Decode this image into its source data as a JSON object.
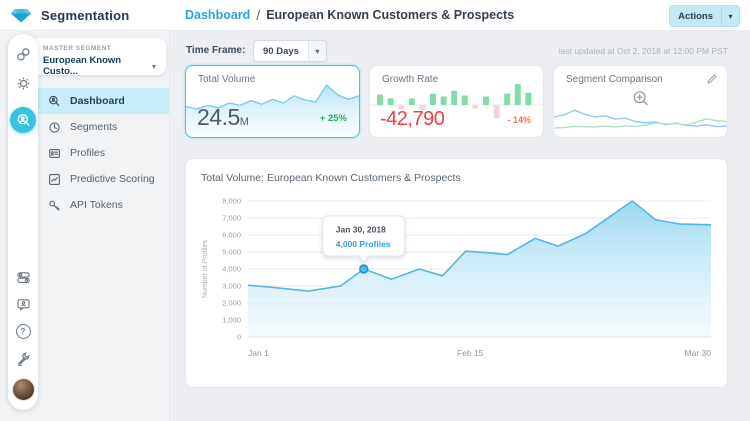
{
  "colors": {
    "accent": "#35c3df",
    "accent_light": "#c9edf6",
    "link_blue": "#2aa3dc",
    "positive_green": "#27ae60",
    "negative_red": "#ef4049",
    "warn_orange": "#f2714b"
  },
  "app": {
    "title": "Segmentation"
  },
  "header": {
    "breadcrumb_link": "Dashboard",
    "breadcrumb_separator": "/",
    "breadcrumb_current": "European Known Customers & Prospects",
    "actions_label": "Actions"
  },
  "icons": {
    "chevron_down": "▾",
    "help_glyph": "?"
  },
  "rail": {
    "top_icons": [
      "links-icon",
      "gear-icon",
      "search-user-icon"
    ],
    "active_icon": "search-user-icon",
    "bottom_icons": [
      "toggles-icon",
      "contact-chat-icon",
      "help-icon",
      "wrench-icon",
      "user-avatar"
    ]
  },
  "sidebar": {
    "master_segment_label": "MASTER SEGMENT",
    "master_segment_value": "European Known Custo...",
    "items": [
      {
        "label": "Dashboard",
        "icon": "dashboard-search-icon",
        "active": true
      },
      {
        "label": "Segments",
        "icon": "segments-clock-icon",
        "active": false
      },
      {
        "label": "Profiles",
        "icon": "profiles-card-icon",
        "active": false
      },
      {
        "label": "Predictive Scoring",
        "icon": "predictive-chart-icon",
        "active": false
      },
      {
        "label": "API Tokens",
        "icon": "api-key-icon",
        "active": false
      }
    ]
  },
  "toolbar": {
    "time_frame_label": "Time Frame:",
    "time_frame_value": "90 Days",
    "last_updated": "last updated at Oct 2, 2018 at 12:00 PM PST"
  },
  "cards": {
    "total_volume": {
      "title": "Total Volume",
      "value": "24.5",
      "unit": "M",
      "delta": "+ 25%"
    },
    "growth_rate": {
      "title": "Growth Rate",
      "value": "-42,790",
      "delta": "- 14%"
    },
    "segment_comparison": {
      "title": "Segment Comparison"
    }
  },
  "chart_data": [
    {
      "id": "main-volume",
      "type": "area",
      "title": "Total Volume: European Known Customers & Prospects",
      "xlabel": "",
      "ylabel": "Number of Profiles",
      "ylim": [
        0,
        8000
      ],
      "yticks": [
        0,
        1000,
        2000,
        3000,
        4000,
        5000,
        6000,
        7000,
        8000
      ],
      "xticks": [
        {
          "label": "Jan 1",
          "pos": 0
        },
        {
          "label": "Feb 15",
          "pos": 0.48
        },
        {
          "label": "Mar 30",
          "pos": 1
        }
      ],
      "x": [
        0,
        0.06,
        0.13,
        0.2,
        0.25,
        0.31,
        0.37,
        0.42,
        0.47,
        0.52,
        0.56,
        0.62,
        0.67,
        0.73,
        0.83,
        0.88,
        0.93,
        1
      ],
      "values": [
        3050,
        2900,
        2700,
        3000,
        4000,
        3400,
        4000,
        3600,
        5050,
        4950,
        4850,
        5800,
        5350,
        6100,
        8000,
        6900,
        6650,
        6600
      ],
      "marker": {
        "index": 4,
        "date": "Jan 30, 2018",
        "label": "4,000 Profiles"
      },
      "grid": true,
      "legend": "none",
      "line_color": "#54b6e3",
      "fill_top": "#90d5ee",
      "fill_bottom": "#eaf7fc"
    },
    {
      "id": "volume-spark",
      "type": "area",
      "values": [
        44,
        40,
        46,
        42,
        50,
        46,
        54,
        48,
        56,
        50,
        62,
        55,
        52,
        80,
        64,
        56,
        62
      ],
      "line_color": "#7cc8e8",
      "fill_top": "#ade0f3",
      "fill_bottom": "#eef9fd"
    },
    {
      "id": "growth-bars",
      "type": "bar",
      "values": [
        11,
        7,
        -5,
        7,
        -5,
        12,
        9,
        15,
        10,
        -4,
        9,
        -14,
        12,
        22,
        13
      ],
      "positive_color": "#83dba8",
      "negative_color": "#f6d2d9"
    },
    {
      "id": "segment-lines",
      "type": "line",
      "series": [
        {
          "color": "#8ccdec",
          "values": [
            52,
            58,
            72,
            60,
            52,
            55,
            45,
            48,
            38,
            34,
            36,
            28,
            33,
            26,
            24,
            28,
            22,
            25
          ]
        },
        {
          "color": "#a9e2c3",
          "values": [
            18,
            20,
            23,
            22,
            21,
            24,
            21,
            25,
            23,
            27,
            33,
            30,
            32,
            28,
            36,
            46,
            40,
            38
          ]
        }
      ]
    }
  ]
}
